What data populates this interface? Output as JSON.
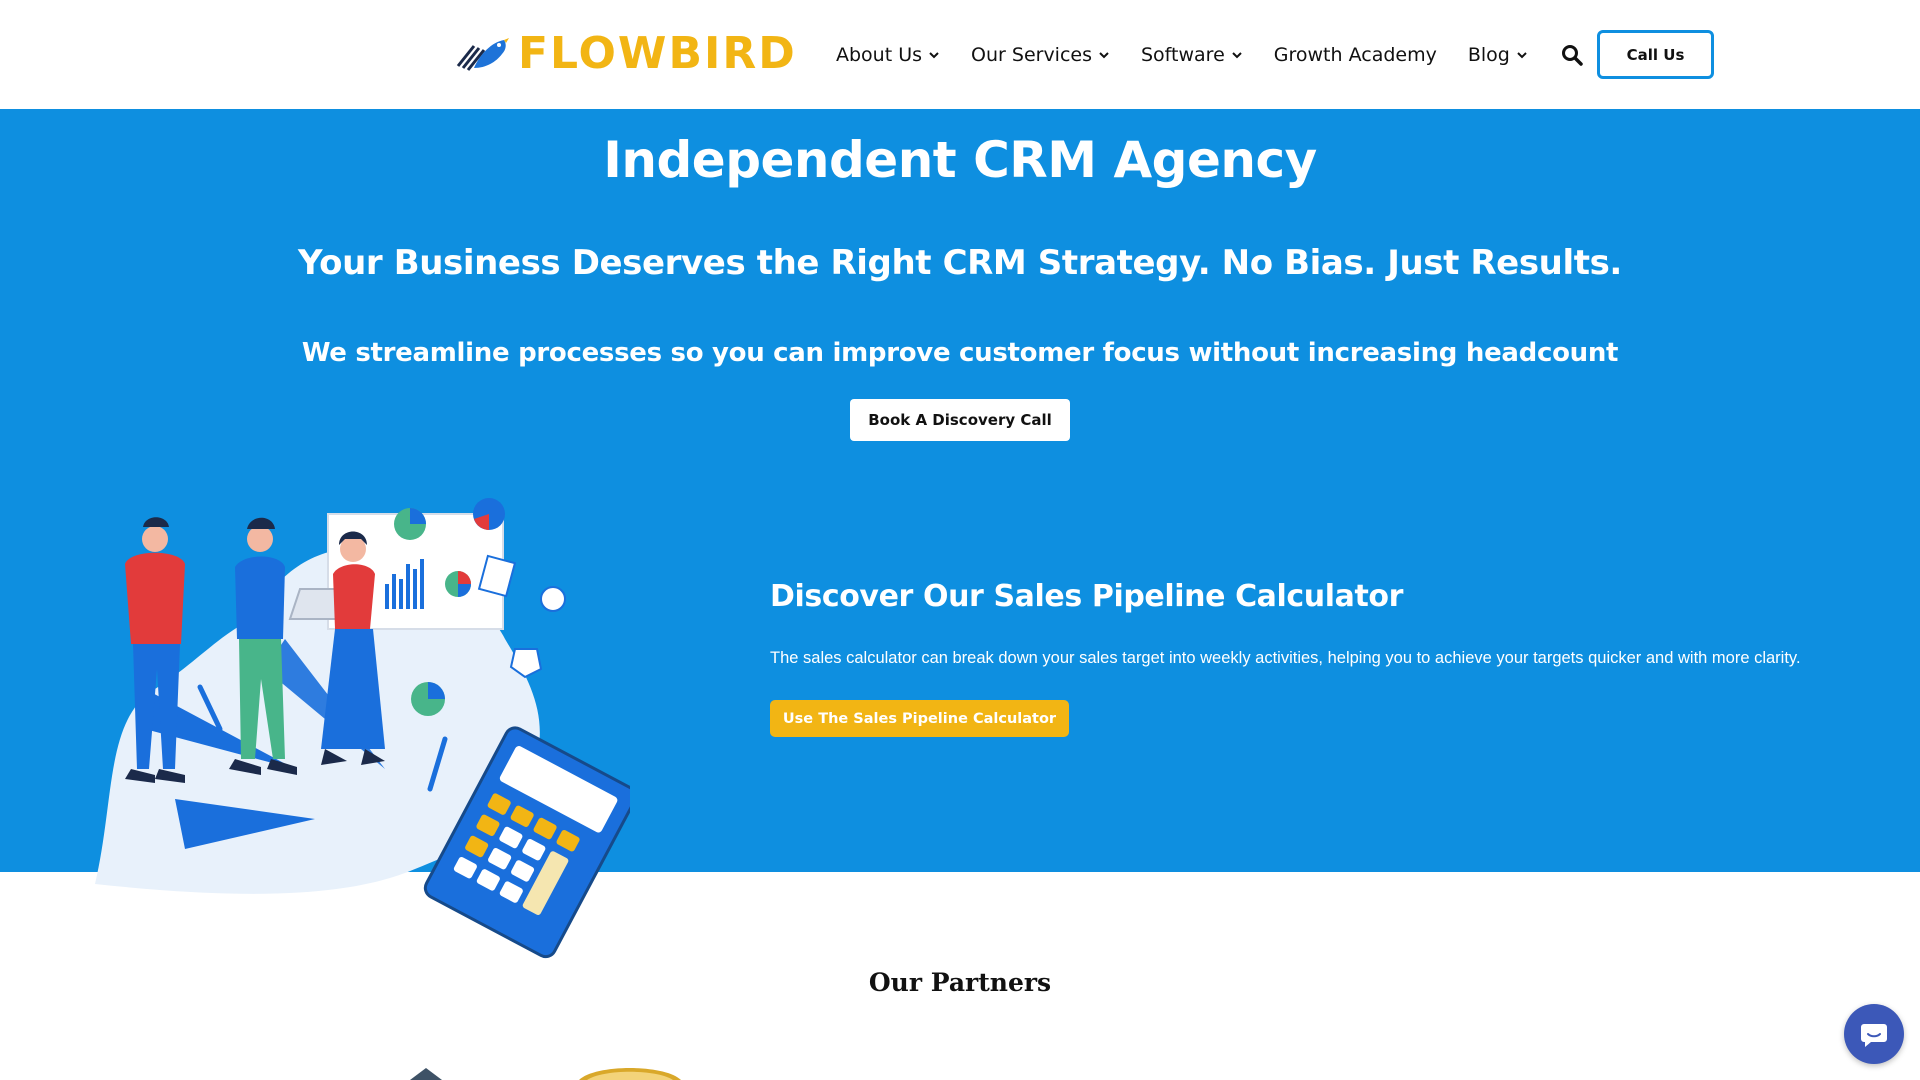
{
  "brand": {
    "name": "FLOWBIRD",
    "color": "#f2b514",
    "icon": "bird-logo-icon"
  },
  "nav": {
    "items": [
      {
        "label": "About Us",
        "has_dropdown": true
      },
      {
        "label": "Our Services",
        "has_dropdown": true
      },
      {
        "label": "Software",
        "has_dropdown": true
      },
      {
        "label": "Growth Academy",
        "has_dropdown": false
      },
      {
        "label": "Blog",
        "has_dropdown": true
      }
    ],
    "search_icon": "search-icon",
    "call_label": "Call Us"
  },
  "hero": {
    "background": "#0e8fe0",
    "title": "Independent CRM Agency",
    "subtitle": "Your Business Deserves the Right CRM Strategy. No Bias. Just Results.",
    "tagline": "We streamline processes so you can improve customer focus without increasing headcount",
    "cta_label": "Book A Discovery Call"
  },
  "calculator": {
    "title": "Discover Our Sales Pipeline Calculator",
    "description": "The sales calculator can break down your sales target into weekly activities, helping you to achieve your targets quicker and with more clarity.",
    "button_label": "Use The Sales Pipeline Calculator",
    "button_color": "#f2b514"
  },
  "partners": {
    "title": "Our Partners"
  },
  "chat": {
    "icon": "chat-bubble-icon",
    "color": "#3c58b8"
  }
}
